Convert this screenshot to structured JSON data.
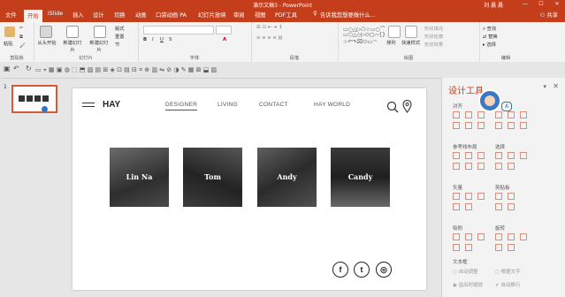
{
  "window": {
    "title": "演示文稿3 - PowerPoint",
    "user": "刘 晨 晨",
    "controls": [
      "—",
      "☐",
      "✕"
    ]
  },
  "tabs": [
    {
      "label": "文件",
      "active": false
    },
    {
      "label": "开始",
      "active": true
    },
    {
      "label": "iSlide",
      "active": false
    },
    {
      "label": "插入",
      "active": false
    },
    {
      "label": "设计",
      "active": false
    },
    {
      "label": "切换",
      "active": false
    },
    {
      "label": "动画",
      "active": false
    },
    {
      "label": "口袋动画 PA",
      "active": false
    },
    {
      "label": "幻灯片放映",
      "active": false
    },
    {
      "label": "审阅",
      "active": false
    },
    {
      "label": "视图",
      "active": false
    },
    {
      "label": "PDF工具",
      "active": false
    },
    {
      "label": "告诉我您想要做什么...",
      "active": false
    }
  ],
  "share_label": "共享",
  "ribbon": {
    "groups": [
      {
        "label": "剪贴板"
      },
      {
        "label": "幻灯片"
      },
      {
        "label": "字体"
      },
      {
        "label": "段落"
      },
      {
        "label": "绘图"
      },
      {
        "label": "编辑"
      }
    ],
    "paste": "粘贴",
    "cut": "剪切",
    "from_start": "从头开始",
    "new_slide": "新建幻灯片",
    "new_slide2": "新建幻灯片",
    "layout": "版式",
    "reset": "重置",
    "section": "节",
    "find": "查找",
    "replace": "替换",
    "select": "选择",
    "shape_fill": "形状填充",
    "shape_outline": "形状轮廓",
    "shape_effect": "形状效果",
    "quick_styles": "快速样式",
    "arrange": "排列"
  },
  "slide_number": "1",
  "slide": {
    "logo": "HAY",
    "nav": [
      "DESIGNER",
      "LIVING",
      "CONTACT",
      "HAY WORLD"
    ],
    "cards": [
      {
        "name": "Lin Na"
      },
      {
        "name": "Tom"
      },
      {
        "name": "Andy"
      },
      {
        "name": "Candy"
      }
    ],
    "social": [
      "f",
      "t",
      "◎"
    ]
  },
  "pane": {
    "title": "设计工具",
    "sections": {
      "align": "对齐",
      "guides": "参考线布局",
      "select": "选择",
      "vector": "矢量",
      "clip": "剪贴板",
      "snap": "吸附",
      "rotate": "旋转",
      "textbox": "文本框",
      "opt1": "自动调整",
      "opt2": "根据文字",
      "opt3": "溢出时缩放",
      "opt4": "自动换行"
    }
  },
  "colors": {
    "accent": "#c43e1c",
    "ribbon_bg": "#f3f3f3"
  }
}
